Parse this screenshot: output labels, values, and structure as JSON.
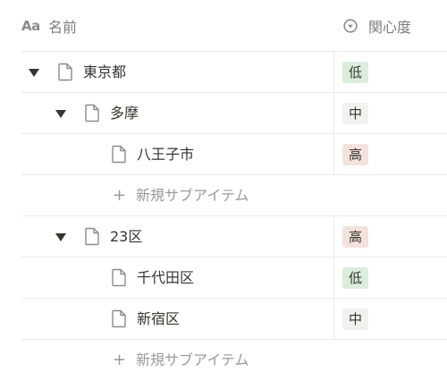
{
  "header": {
    "name_icon": "Aa",
    "name_label": "名前",
    "interest_label": "関心度"
  },
  "rows": [
    {
      "kind": "item",
      "level": 0,
      "toggle": true,
      "label": "東京都",
      "tag": "低",
      "tag_color": "#dbeddb"
    },
    {
      "kind": "item",
      "level": 1,
      "toggle": true,
      "label": "多摩",
      "tag": "中",
      "tag_color": "#f1f1ef"
    },
    {
      "kind": "item",
      "level": 2,
      "toggle": false,
      "label": "八王子市",
      "tag": "高",
      "tag_color": "#f4e2dc"
    },
    {
      "kind": "add",
      "level": 2,
      "label": "新規サブアイテム"
    },
    {
      "kind": "item",
      "level": 1,
      "toggle": true,
      "label": "23区",
      "tag": "高",
      "tag_color": "#f4e2dc"
    },
    {
      "kind": "item",
      "level": 2,
      "toggle": false,
      "label": "千代田区",
      "tag": "低",
      "tag_color": "#dbeddb"
    },
    {
      "kind": "item",
      "level": 2,
      "toggle": false,
      "label": "新宿区",
      "tag": "中",
      "tag_color": "#f1f1ef"
    },
    {
      "kind": "add",
      "level": 2,
      "label": "新規サブアイテム"
    }
  ],
  "icons": {
    "toggle": "triangle-down-icon",
    "page": "page-icon",
    "add": "plus-icon",
    "select": "select-property-icon"
  }
}
